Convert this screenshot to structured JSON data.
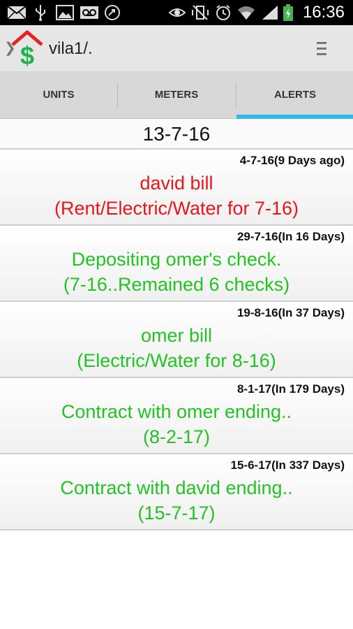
{
  "status_bar": {
    "time": "16:36",
    "battery_color": "#4caf50",
    "icons": [
      "mail-icon",
      "usb-icon",
      "image-icon",
      "voicemail-icon",
      "sync-icon",
      "eye-icon",
      "no-vibrate-icon",
      "alarm-icon",
      "wifi-icon",
      "signal-icon",
      "battery-icon"
    ]
  },
  "app_bar": {
    "title": "vila1/.",
    "icon": "house-dollar-icon"
  },
  "tabs": [
    {
      "label": "UNITS",
      "selected": false
    },
    {
      "label": "METERS",
      "selected": false
    },
    {
      "label": "ALERTS",
      "selected": true
    }
  ],
  "date_header": "13-7-16",
  "alerts": [
    {
      "date": "4-7-16(9 Days ago)",
      "line1": "david bill",
      "line2": "(Rent/Electric/Water for 7-16)",
      "color": "#e8161b"
    },
    {
      "date": "29-7-16(In 16 Days)",
      "line1": "Depositing omer's check.",
      "line2": "(7-16..Remained 6 checks)",
      "color": "#22c322"
    },
    {
      "date": "19-8-16(In 37 Days)",
      "line1": "omer bill",
      "line2": "(Electric/Water for 8-16)",
      "color": "#22c322"
    },
    {
      "date": "8-1-17(In 179 Days)",
      "line1": "Contract with omer ending..",
      "line2": "(8-2-17)",
      "color": "#22c322"
    },
    {
      "date": "15-6-17(In 337 Days)",
      "line1": "Contract with david ending..",
      "line2": "(15-7-17)",
      "color": "#22c322"
    }
  ],
  "colors": {
    "tab_indicator": "#33b5e5",
    "overdue": "#e8161b",
    "upcoming": "#22c322"
  }
}
